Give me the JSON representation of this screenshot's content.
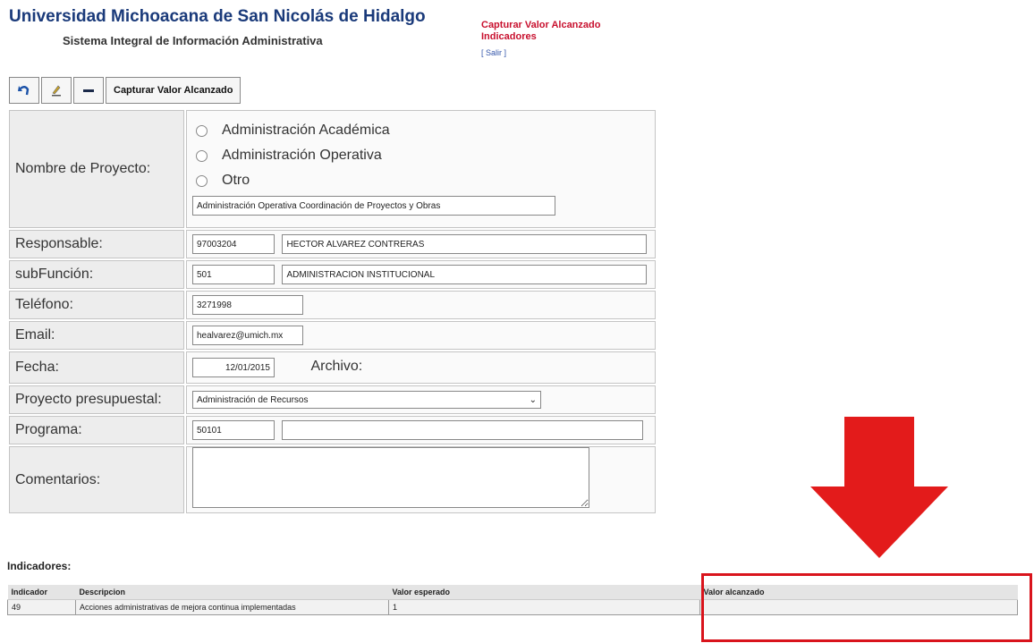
{
  "header": {
    "university": "Universidad Michoacana de San Nicolás de Hidalgo",
    "system": "Sistema Integral de Información Administrativa",
    "page_title_line1": "Capturar Valor Alcanzado",
    "page_title_line2": "Indicadores",
    "exit_link": "[ Salir ]"
  },
  "toolbar": {
    "undo_icon": "undo-icon",
    "edit_icon": "pencil-icon",
    "minus_icon": "minus-icon",
    "capture_label": "Capturar Valor Alcanzado"
  },
  "form": {
    "project_label": "Nombre de Proyecto:",
    "project_options": [
      "Administración Académica",
      "Administración Operativa",
      "Otro"
    ],
    "project_value": "Administración Operativa Coordinación de Proyectos y Obras",
    "responsible_label": "Responsable:",
    "responsible_id": "97003204",
    "responsible_name": "HECTOR ALVAREZ CONTRERAS",
    "subfunction_label": "subFunción:",
    "subfunction_code": "501",
    "subfunction_name": "ADMINISTRACION INSTITUCIONAL",
    "phone_label": "Teléfono:",
    "phone_value": "3271998",
    "email_label": "Email:",
    "email_value": "healvarez@umich.mx",
    "date_label": "Fecha:",
    "date_value": "12/01/2015",
    "file_label": "Archivo:",
    "budget_label": "Proyecto presupuestal:",
    "budget_value": "Administración de Recursos",
    "program_label": "Programa:",
    "program_code": "50101",
    "program_name": "",
    "comments_label": "Comentarios:",
    "comments_value": ""
  },
  "indicators": {
    "heading": "Indicadores:",
    "columns": [
      "Indicador",
      "Descripcion",
      "Valor esperado",
      "Valor alcanzado"
    ],
    "rows": [
      {
        "indicator": "49",
        "description": "Acciones administrativas de mejora continua implementadas",
        "expected": "1",
        "achieved": ""
      }
    ]
  },
  "annotation": {
    "arrow_color": "#e31b1b",
    "box_color": "#d9141c"
  }
}
